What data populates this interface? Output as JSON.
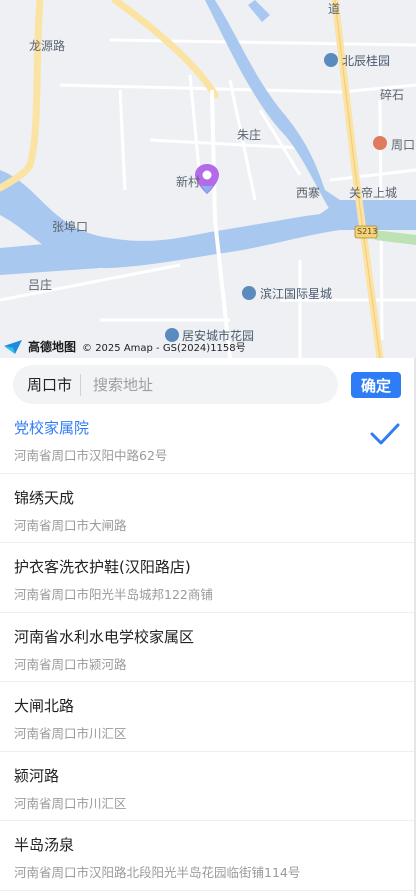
{
  "map": {
    "labels": {
      "longyuan_road": "龙源路",
      "dao": "道",
      "beichen_guiyuan": "北辰桂园",
      "suishi": "碎石",
      "zhuzhuang": "朱庄",
      "zhoukou": "周口",
      "xincun": "新村",
      "xizhai": "西寨",
      "guandi": "关帝上城",
      "zhangbukou": "张埠口",
      "s213": "S213",
      "lvzhuang": "吕庄",
      "binjiang": "滨江国际星城",
      "juan": "居安城市花园"
    },
    "attribution": {
      "logo_text": "高德地图",
      "copyright": "© 2025 Amap - GS(2024)1158号"
    }
  },
  "search": {
    "city": "周口市",
    "placeholder": "搜索地址",
    "value": "",
    "confirm_label": "确定"
  },
  "results": [
    {
      "name": "党校家属院",
      "address": "河南省周口市汉阳中路62号",
      "selected": true
    },
    {
      "name": "锦绣天成",
      "address": "河南省周口市大闸路",
      "selected": false
    },
    {
      "name": "护衣客洗衣护鞋(汉阳路店)",
      "address": "河南省周口市阳光半岛城邦122商铺",
      "selected": false
    },
    {
      "name": "河南省水利水电学校家属区",
      "address": "河南省周口市颍河路",
      "selected": false
    },
    {
      "name": "大闸北路",
      "address": "河南省周口市川汇区",
      "selected": false
    },
    {
      "name": "颍河路",
      "address": "河南省周口市川汇区",
      "selected": false
    },
    {
      "name": "半岛汤泉",
      "address": "河南省周口市汉阳路北段阳光半岛花园临街铺114号",
      "selected": false
    }
  ],
  "colors": {
    "accent": "#2f7df6",
    "river": "#a8c8f0",
    "road_major": "#fbe3a3",
    "marker": "#b36be8"
  }
}
